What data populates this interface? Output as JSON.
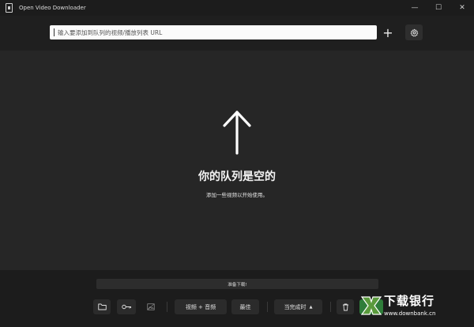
{
  "window": {
    "title": "Open Video Downloader",
    "minimize_glyph": "—",
    "maximize_glyph": "☐",
    "close_glyph": "✕"
  },
  "toolbar": {
    "url_placeholder": "输入要添加到队列的视频/播放列表 URL",
    "add_glyph": "+",
    "settings_icon": "gear-icon"
  },
  "empty_state": {
    "icon": "arrow-up-icon",
    "title": "你的队列是空的",
    "subtitle": "添加一些视频以开始使用。"
  },
  "footer": {
    "status": "准备下载!",
    "folder_icon": "folder-icon",
    "key_icon": "key-icon",
    "image_icon": "image-icon",
    "format_label": "视频 + 音频",
    "quality_label": "最佳",
    "on_complete_label": "当完成时",
    "on_complete_chevron": "▲",
    "delete_icon": "trash-icon",
    "download_icon": "download-icon"
  },
  "watermark": {
    "text": "下载银行",
    "url": "www.downbank.cn"
  }
}
